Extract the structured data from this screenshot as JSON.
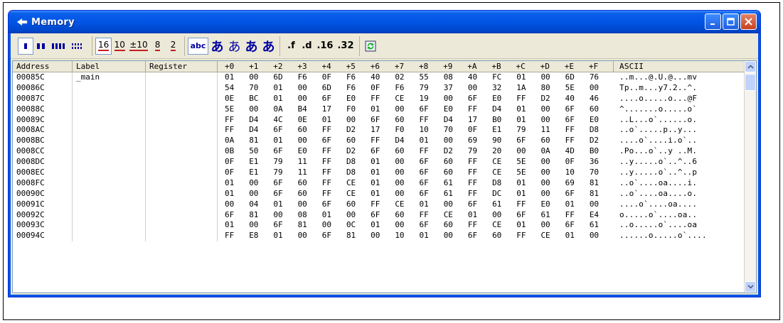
{
  "window": {
    "title": "Memory"
  },
  "toolbar": {
    "width_buttons": [
      {
        "icon": "width-1-icon"
      },
      {
        "icon": "width-2-icon"
      },
      {
        "icon": "width-4-icon"
      },
      {
        "icon": "width-8-icon"
      }
    ],
    "radix_buttons": [
      "16",
      "10",
      "±10",
      "8",
      "2"
    ],
    "display_buttons": [
      "abc",
      "あ",
      "あ",
      "あ",
      "あ"
    ],
    "float_buttons": [
      ".f",
      ".d",
      ".16",
      ".32"
    ],
    "refresh_icon": "refresh-icon"
  },
  "colors": {
    "accent_red": "#c42020",
    "title_blue": "#0055e5",
    "face": "#ece9d8"
  },
  "grid": {
    "headers": {
      "address": "Address",
      "label": "Label",
      "register": "Register",
      "offsets": [
        "+0",
        "+1",
        "+2",
        "+3",
        "+4",
        "+5",
        "+6",
        "+7",
        "+8",
        "+9",
        "+A",
        "+B",
        "+C",
        "+D",
        "+E",
        "+F"
      ],
      "ascii": "ASCII"
    },
    "rows": [
      {
        "addr": "00085C",
        "label": "_main",
        "reg": "",
        "bytes": [
          "01",
          "00",
          "6D",
          "F6",
          "0F",
          "F6",
          "40",
          "02",
          "55",
          "08",
          "40",
          "FC",
          "01",
          "00",
          "6D",
          "76"
        ],
        "ascii": "..m...@.U.@...mv"
      },
      {
        "addr": "00086C",
        "label": "",
        "reg": "",
        "bytes": [
          "54",
          "70",
          "01",
          "00",
          "6D",
          "F6",
          "0F",
          "F6",
          "79",
          "37",
          "00",
          "32",
          "1A",
          "80",
          "5E",
          "00"
        ],
        "ascii": "Tp..m...y7.2..^."
      },
      {
        "addr": "00087C",
        "label": "",
        "reg": "",
        "bytes": [
          "0E",
          "BC",
          "01",
          "00",
          "6F",
          "E0",
          "FF",
          "CE",
          "19",
          "00",
          "6F",
          "E0",
          "FF",
          "D2",
          "40",
          "46"
        ],
        "ascii": "....o.....o...@F"
      },
      {
        "addr": "00088C",
        "label": "",
        "reg": "",
        "bytes": [
          "5E",
          "00",
          "0A",
          "B4",
          "17",
          "F0",
          "01",
          "00",
          "6F",
          "E0",
          "FF",
          "D4",
          "01",
          "00",
          "6F",
          "60"
        ],
        "ascii": "^.......o.....o`"
      },
      {
        "addr": "00089C",
        "label": "",
        "reg": "",
        "bytes": [
          "FF",
          "D4",
          "4C",
          "0E",
          "01",
          "00",
          "6F",
          "60",
          "FF",
          "D4",
          "17",
          "B0",
          "01",
          "00",
          "6F",
          "E0"
        ],
        "ascii": "..L...o`......o."
      },
      {
        "addr": "0008AC",
        "label": "",
        "reg": "",
        "bytes": [
          "FF",
          "D4",
          "6F",
          "60",
          "FF",
          "D2",
          "17",
          "F0",
          "10",
          "70",
          "0F",
          "E1",
          "79",
          "11",
          "FF",
          "D8"
        ],
        "ascii": "..o`.....p..y..."
      },
      {
        "addr": "0008BC",
        "label": "",
        "reg": "",
        "bytes": [
          "0A",
          "81",
          "01",
          "00",
          "6F",
          "60",
          "FF",
          "D4",
          "01",
          "00",
          "69",
          "90",
          "6F",
          "60",
          "FF",
          "D2"
        ],
        "ascii": "....o`....i.o`.."
      },
      {
        "addr": "0008CC",
        "label": "",
        "reg": "",
        "bytes": [
          "0B",
          "50",
          "6F",
          "E0",
          "FF",
          "D2",
          "6F",
          "60",
          "FF",
          "D2",
          "79",
          "20",
          "00",
          "0A",
          "4D",
          "B0"
        ],
        "ascii": ".Po...o`..y ..M."
      },
      {
        "addr": "0008DC",
        "label": "",
        "reg": "",
        "bytes": [
          "0F",
          "E1",
          "79",
          "11",
          "FF",
          "D8",
          "01",
          "00",
          "6F",
          "60",
          "FF",
          "CE",
          "5E",
          "00",
          "0F",
          "36"
        ],
        "ascii": "..y.....o`..^..6"
      },
      {
        "addr": "0008EC",
        "label": "",
        "reg": "",
        "bytes": [
          "0F",
          "E1",
          "79",
          "11",
          "FF",
          "D8",
          "01",
          "00",
          "6F",
          "60",
          "FF",
          "CE",
          "5E",
          "00",
          "10",
          "70"
        ],
        "ascii": "..y.....o`..^..p"
      },
      {
        "addr": "0008FC",
        "label": "",
        "reg": "",
        "bytes": [
          "01",
          "00",
          "6F",
          "60",
          "FF",
          "CE",
          "01",
          "00",
          "6F",
          "61",
          "FF",
          "D8",
          "01",
          "00",
          "69",
          "81"
        ],
        "ascii": "..o`....oa....i."
      },
      {
        "addr": "00090C",
        "label": "",
        "reg": "",
        "bytes": [
          "01",
          "00",
          "6F",
          "60",
          "FF",
          "CE",
          "01",
          "00",
          "6F",
          "61",
          "FF",
          "DC",
          "01",
          "00",
          "6F",
          "81"
        ],
        "ascii": "..o`....oa....o."
      },
      {
        "addr": "00091C",
        "label": "",
        "reg": "",
        "bytes": [
          "00",
          "04",
          "01",
          "00",
          "6F",
          "60",
          "FF",
          "CE",
          "01",
          "00",
          "6F",
          "61",
          "FF",
          "E0",
          "01",
          "00"
        ],
        "ascii": "....o`....oa...."
      },
      {
        "addr": "00092C",
        "label": "",
        "reg": "",
        "bytes": [
          "6F",
          "81",
          "00",
          "08",
          "01",
          "00",
          "6F",
          "60",
          "FF",
          "CE",
          "01",
          "00",
          "6F",
          "61",
          "FF",
          "E4"
        ],
        "ascii": "o.....o`....oa.."
      },
      {
        "addr": "00093C",
        "label": "",
        "reg": "",
        "bytes": [
          "01",
          "00",
          "6F",
          "81",
          "00",
          "0C",
          "01",
          "00",
          "6F",
          "60",
          "FF",
          "CE",
          "01",
          "00",
          "6F",
          "61"
        ],
        "ascii": "..o.....o`....oa"
      },
      {
        "addr": "00094C",
        "label": "",
        "reg": "",
        "bytes": [
          "FF",
          "E8",
          "01",
          "00",
          "6F",
          "81",
          "00",
          "10",
          "01",
          "00",
          "6F",
          "60",
          "FF",
          "CE",
          "01",
          "00"
        ],
        "ascii": "......o.....o`...."
      }
    ]
  }
}
